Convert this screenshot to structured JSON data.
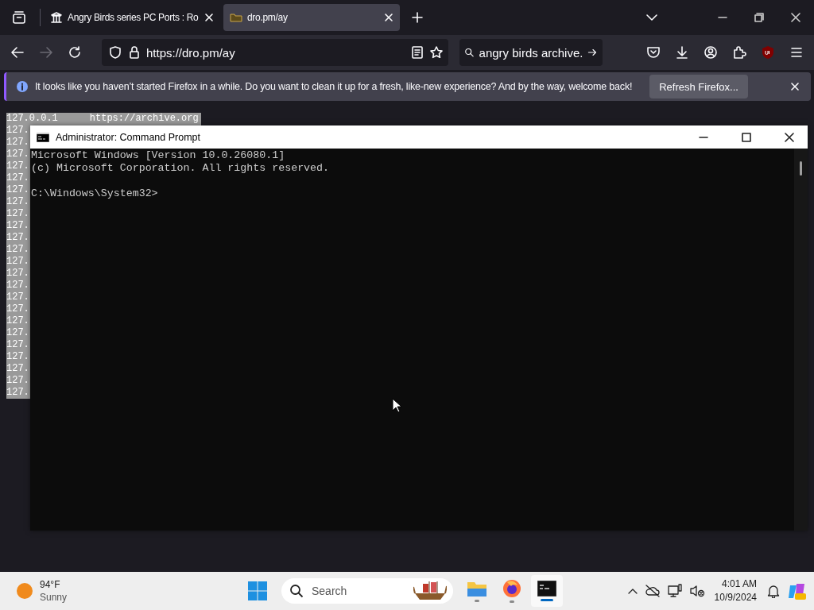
{
  "browser": {
    "tabs": [
      {
        "title": "Angry Birds series PC Ports : Ro",
        "kind": "archive",
        "selected": false
      },
      {
        "title": "dro.pm/ay",
        "kind": "site",
        "selected": true
      }
    ],
    "address": "https://dro.pm/ay",
    "search": "angry birds archive.",
    "notification": {
      "message": "It looks like you haven’t started Firefox in a while. Do you want to clean it up for a fresh, like-new experience? And by the way, welcome back!",
      "button": "Refresh Firefox..."
    }
  },
  "page": {
    "lines": [
      {
        "ip": "127.0.0.1",
        "url": "https://archive.org"
      },
      {
        "ip": "127."
      },
      {
        "ip": "127."
      },
      {
        "ip": "127."
      },
      {
        "ip": "127."
      },
      {
        "ip": "127."
      },
      {
        "ip": "127."
      },
      {
        "ip": "127."
      },
      {
        "ip": "127."
      },
      {
        "ip": "127."
      },
      {
        "ip": "127."
      },
      {
        "ip": "127."
      },
      {
        "ip": "127."
      },
      {
        "ip": "127."
      },
      {
        "ip": "127."
      },
      {
        "ip": "127."
      },
      {
        "ip": "127."
      },
      {
        "ip": "127."
      },
      {
        "ip": "127."
      },
      {
        "ip": "127."
      },
      {
        "ip": "127."
      },
      {
        "ip": "127."
      },
      {
        "ip": "127."
      },
      {
        "ip": "127."
      }
    ]
  },
  "console": {
    "title": "Administrator: Command Prompt",
    "output": [
      "Microsoft Windows [Version 10.0.26080.1]",
      "(c) Microsoft Corporation. All rights reserved."
    ],
    "prompt": "C:\\Windows\\System32>"
  },
  "taskbar": {
    "weather": {
      "temperature": "94°F",
      "condition": "Sunny"
    },
    "search": {
      "placeholder": "Search"
    },
    "apps": [
      {
        "kind": "files",
        "selected": false
      },
      {
        "kind": "firefox",
        "selected": false
      },
      {
        "kind": "terminal",
        "selected": true
      }
    ],
    "time": "4:01 AM",
    "date": "10/9/2024"
  }
}
